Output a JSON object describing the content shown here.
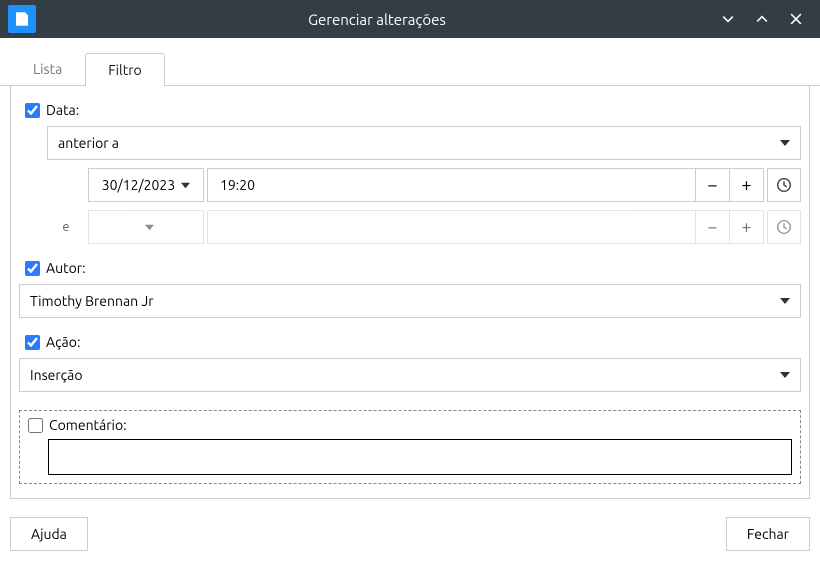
{
  "window": {
    "title": "Gerenciar alterações"
  },
  "tabs": {
    "list": "Lista",
    "filter": "Filtro"
  },
  "filter": {
    "date_label": "Data:",
    "date_condition": "anterior a",
    "date1": "30/12/2023",
    "time1": "19:20",
    "conj": "e",
    "date2": "",
    "time2": "",
    "author_label": "Autor:",
    "author_value": "Timothy Brennan Jr",
    "action_label": "Ação:",
    "action_value": "Inserção",
    "comment_label": "Comentário:",
    "comment_value": ""
  },
  "buttons": {
    "help": "Ajuda",
    "close": "Fechar"
  },
  "checked": {
    "date": true,
    "author": true,
    "action": true,
    "comment": false
  }
}
